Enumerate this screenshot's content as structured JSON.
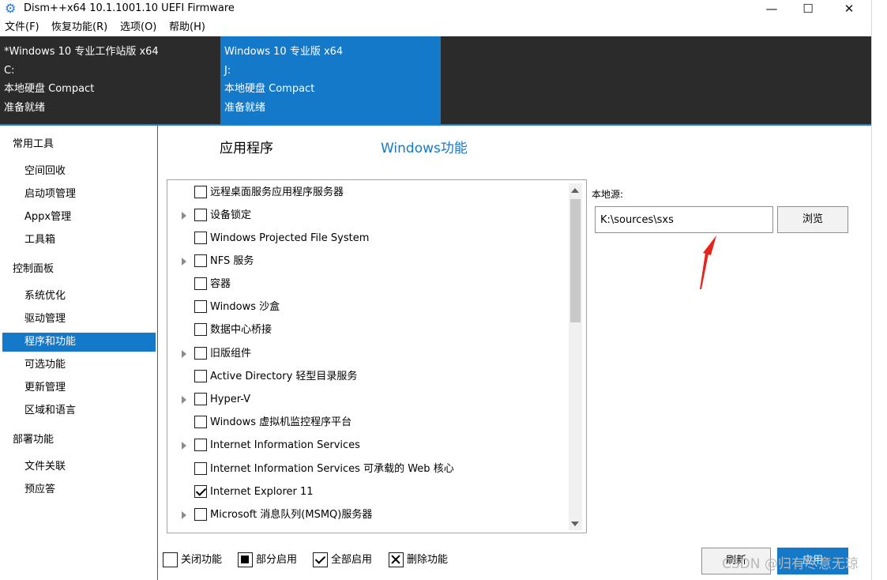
{
  "window": {
    "title": "Dism++x64 10.1.1001.10 UEFI Firmware",
    "minimize": "—",
    "maximize": "☐",
    "close": "✕"
  },
  "menu": [
    {
      "label": "文件(F)"
    },
    {
      "label": "恢复功能(R)"
    },
    {
      "label": "选项(O)"
    },
    {
      "label": "帮助(H)"
    }
  ],
  "images": [
    {
      "name": "*Windows 10 专业工作站版 x64",
      "drive": "C:",
      "disk": "本地硬盘 Compact",
      "status": "准备就绪"
    },
    {
      "name": "Windows 10 专业版 x64",
      "drive": "J:",
      "disk": "本地硬盘 Compact",
      "status": "准备就绪"
    }
  ],
  "sidebar": {
    "groups": [
      {
        "label": "常用工具",
        "items": [
          "空间回收",
          "启动项管理",
          "Appx管理",
          "工具箱"
        ]
      },
      {
        "label": "控制面板",
        "items": [
          "系统优化",
          "驱动管理",
          "程序和功能",
          "可选功能",
          "更新管理",
          "区域和语言"
        ]
      },
      {
        "label": "部署功能",
        "items": [
          "文件关联",
          "预应答"
        ]
      }
    ],
    "active_item": "程序和功能"
  },
  "tabs": [
    {
      "label": "应用程序"
    },
    {
      "label": "Windows功能"
    }
  ],
  "active_tab": "Windows功能",
  "features": [
    {
      "label": "远程桌面服务应用程序服务器",
      "expandable": false,
      "checked": false
    },
    {
      "label": "设备锁定",
      "expandable": true,
      "checked": false
    },
    {
      "label": "Windows Projected File System",
      "expandable": false,
      "checked": false
    },
    {
      "label": "NFS 服务",
      "expandable": true,
      "checked": false
    },
    {
      "label": "容器",
      "expandable": false,
      "checked": false
    },
    {
      "label": "Windows 沙盒",
      "expandable": false,
      "checked": false
    },
    {
      "label": "数据中心桥接",
      "expandable": false,
      "checked": false
    },
    {
      "label": "旧版组件",
      "expandable": true,
      "checked": false
    },
    {
      "label": "Active Directory 轻型目录服务",
      "expandable": false,
      "checked": false
    },
    {
      "label": "Hyper-V",
      "expandable": true,
      "checked": false
    },
    {
      "label": "Windows 虚拟机监控程序平台",
      "expandable": false,
      "checked": false
    },
    {
      "label": "Internet Information Services",
      "expandable": true,
      "checked": false
    },
    {
      "label": "Internet Information Services 可承载的 Web 核心",
      "expandable": false,
      "checked": false
    },
    {
      "label": "Internet Explorer 11",
      "expandable": false,
      "checked": true
    },
    {
      "label": "Microsoft 消息队列(MSMQ)服务器",
      "expandable": true,
      "checked": false
    }
  ],
  "source": {
    "label": "本地源:",
    "value": "K:\\sources\\sxs",
    "browse_label": "浏览"
  },
  "legend": {
    "off": "关闭功能",
    "partial": "部分启用",
    "full": "全部启用",
    "remove": "删除功能"
  },
  "buttons": {
    "refresh": "刷新",
    "apply": "应用"
  },
  "watermark": "CSDN @归有尽意无琼",
  "colors": {
    "accent": "#1479c9",
    "strip_bg": "#2b2b2b",
    "annotation_arrow": "#e8231b"
  }
}
